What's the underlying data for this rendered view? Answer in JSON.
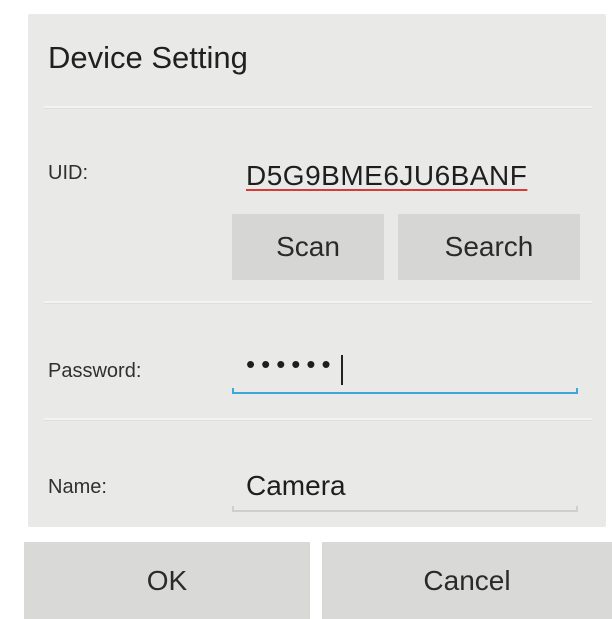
{
  "dialog": {
    "title": "Device Setting"
  },
  "uid": {
    "label": "UID:",
    "value": "D5G9BME6JU6BANF"
  },
  "buttons": {
    "scan": "Scan",
    "search": "Search",
    "ok": "OK",
    "cancel": "Cancel"
  },
  "password": {
    "label": "Password:",
    "value": "••••••"
  },
  "name": {
    "label": "Name:",
    "value": "Camera"
  },
  "colors": {
    "dialog_bg": "#e9e9e7",
    "button_bg": "#d6d6d4",
    "focus_underline": "#3fa6d8",
    "spellcheck_underline": "#d83a3a"
  }
}
